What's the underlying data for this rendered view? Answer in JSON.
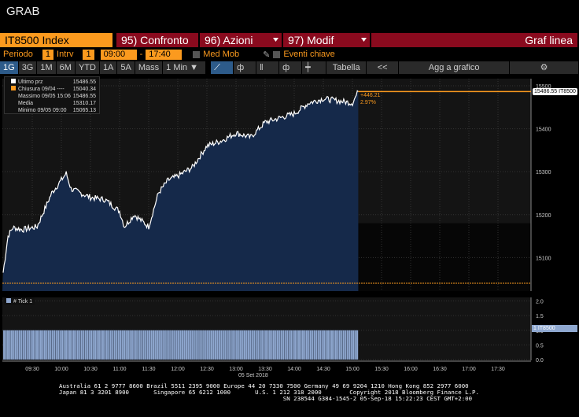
{
  "window_title": "GRAB",
  "toolbar": {
    "ticker": "IT8500 Index",
    "compare": "95) Confronto",
    "actions": "96) Azioni",
    "modify": "97) Modif",
    "chart_type": "Graf linea"
  },
  "settings": {
    "period_label": "Periodo",
    "period_value": "1",
    "interval_label": "Intrv",
    "interval_value": "1",
    "start_time": "09:00",
    "dash": "-",
    "end_time": "17:40",
    "moving_avg": "Med Mob",
    "key_events": "Eventi chiave"
  },
  "ranges": [
    "1G",
    "3G",
    "1M",
    "6M",
    "YTD",
    "1A",
    "5A",
    "Mass"
  ],
  "interval_select": "1 Min ▼",
  "table_label": "Tabella",
  "collapse_label": "<<",
  "add_chart_label": "Agg a grafico",
  "legend": [
    {
      "label": "Ultimo prz",
      "value": "15486.55",
      "color": "#ffffff"
    },
    {
      "label": "Chiusura 09/04 ----",
      "value": "15040.34",
      "color": "#fb9a1e"
    },
    {
      "label": "Massimo 09/05 15:06",
      "value": "15486.55",
      "color": ""
    },
    {
      "label": "Media",
      "value": "15310.17",
      "color": ""
    },
    {
      "label": "Minimo 09/05 09:00",
      "value": "15065.13",
      "color": ""
    }
  ],
  "change": {
    "abs": "+446.21",
    "pct": "2.97%"
  },
  "last_tag": "15486.55 IT8500",
  "tick_legend": "# Tick 1",
  "tick_tag": "1 IT8500",
  "date_label": "05 Set 2018",
  "chart_data": [
    {
      "type": "area",
      "title": "IT8500 Index",
      "ylim": [
        15030,
        15520
      ],
      "yticks": [
        "15500",
        "15400",
        "15300",
        "15200",
        "15100"
      ],
      "xticks": [
        "09:30",
        "10:00",
        "10:30",
        "11:00",
        "11:30",
        "12:00",
        "12:30",
        "13:00",
        "13:30",
        "14:00",
        "14:30",
        "15:00",
        "15:30",
        "16:00",
        "16:30",
        "17:00",
        "17:30"
      ],
      "x_minutes": [
        0,
        5,
        10,
        20,
        35,
        50,
        65,
        70,
        90,
        105,
        120,
        125,
        135,
        150,
        160,
        170,
        180,
        195,
        210,
        225,
        240,
        255,
        270,
        285,
        300,
        315,
        330,
        345,
        360,
        366
      ],
      "y": [
        15065,
        15150,
        15170,
        15165,
        15172,
        15250,
        15296,
        15260,
        15240,
        15235,
        15208,
        15172,
        15200,
        15172,
        15250,
        15280,
        15290,
        15310,
        15360,
        15372,
        15390,
        15380,
        15415,
        15425,
        15435,
        15460,
        15470,
        15465,
        15460,
        15486.55
      ],
      "previous_close": 15040.34,
      "last": 15486.55
    },
    {
      "type": "bar",
      "title": "# Tick 1",
      "ylim": [
        0,
        2.2
      ],
      "yticks": [
        "2.0",
        "1.5",
        "1.0",
        "0.5",
        "0.0"
      ],
      "value": 1,
      "x_range_minutes": [
        0,
        366
      ]
    }
  ],
  "footer": [
    "Australia 61 2 9777 8600 Brazil 5511 2395 9000 Europe 44 20 7330 7500 Germany 49 69 9204 1210 Hong Kong 852 2977 6000",
    "Japan 81 3 3201 8900       Singapore 65 6212 1000       U.S. 1 212 318 2000        Copyright 2018 Bloomberg Finance L.P.",
    "                                                                SN 238544 G384-1545-2 05-Sep-18 15:22:23 CEST GMT+2:00"
  ]
}
